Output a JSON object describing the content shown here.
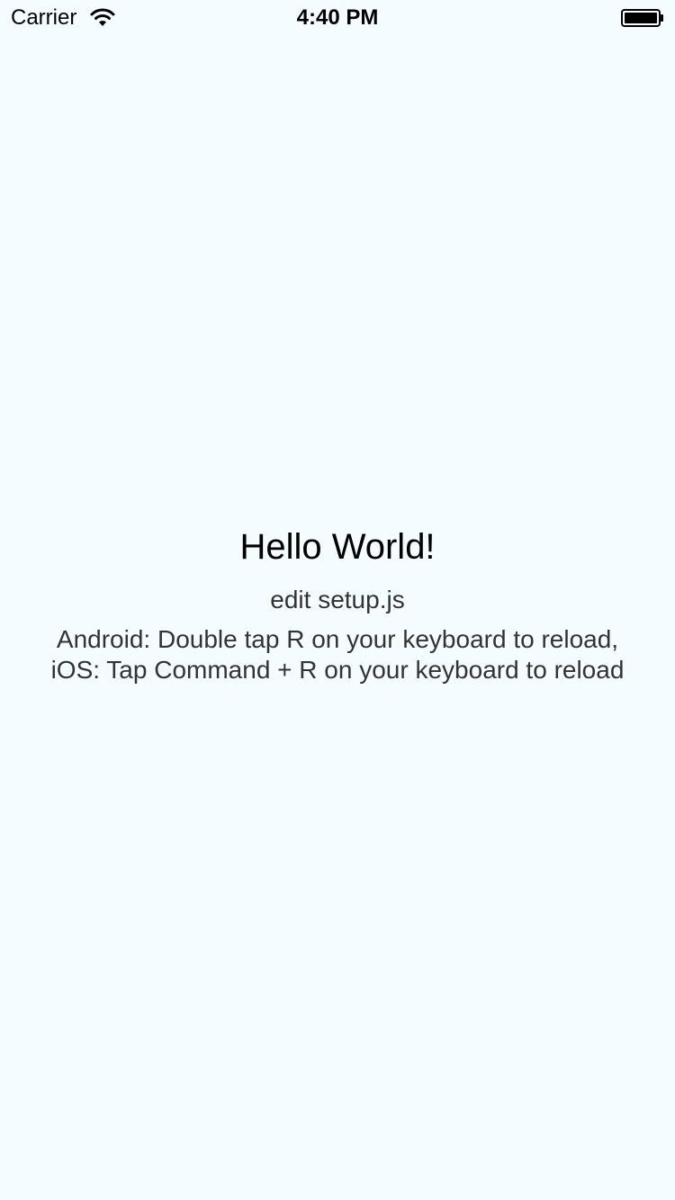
{
  "status_bar": {
    "carrier": "Carrier",
    "time": "4:40 PM",
    "wifi_icon": "wifi-icon",
    "battery_icon": "battery-icon"
  },
  "main": {
    "welcome": "Hello World!",
    "setup_hint": "edit setup.js",
    "reload_line_1": "Android: Double tap R on your keyboard to reload,",
    "reload_line_2": "iOS: Tap Command + R on your keyboard to reload"
  },
  "colors": {
    "background": "#F5FCFF",
    "welcome_text": "#000000",
    "instructions_text": "#333333"
  }
}
